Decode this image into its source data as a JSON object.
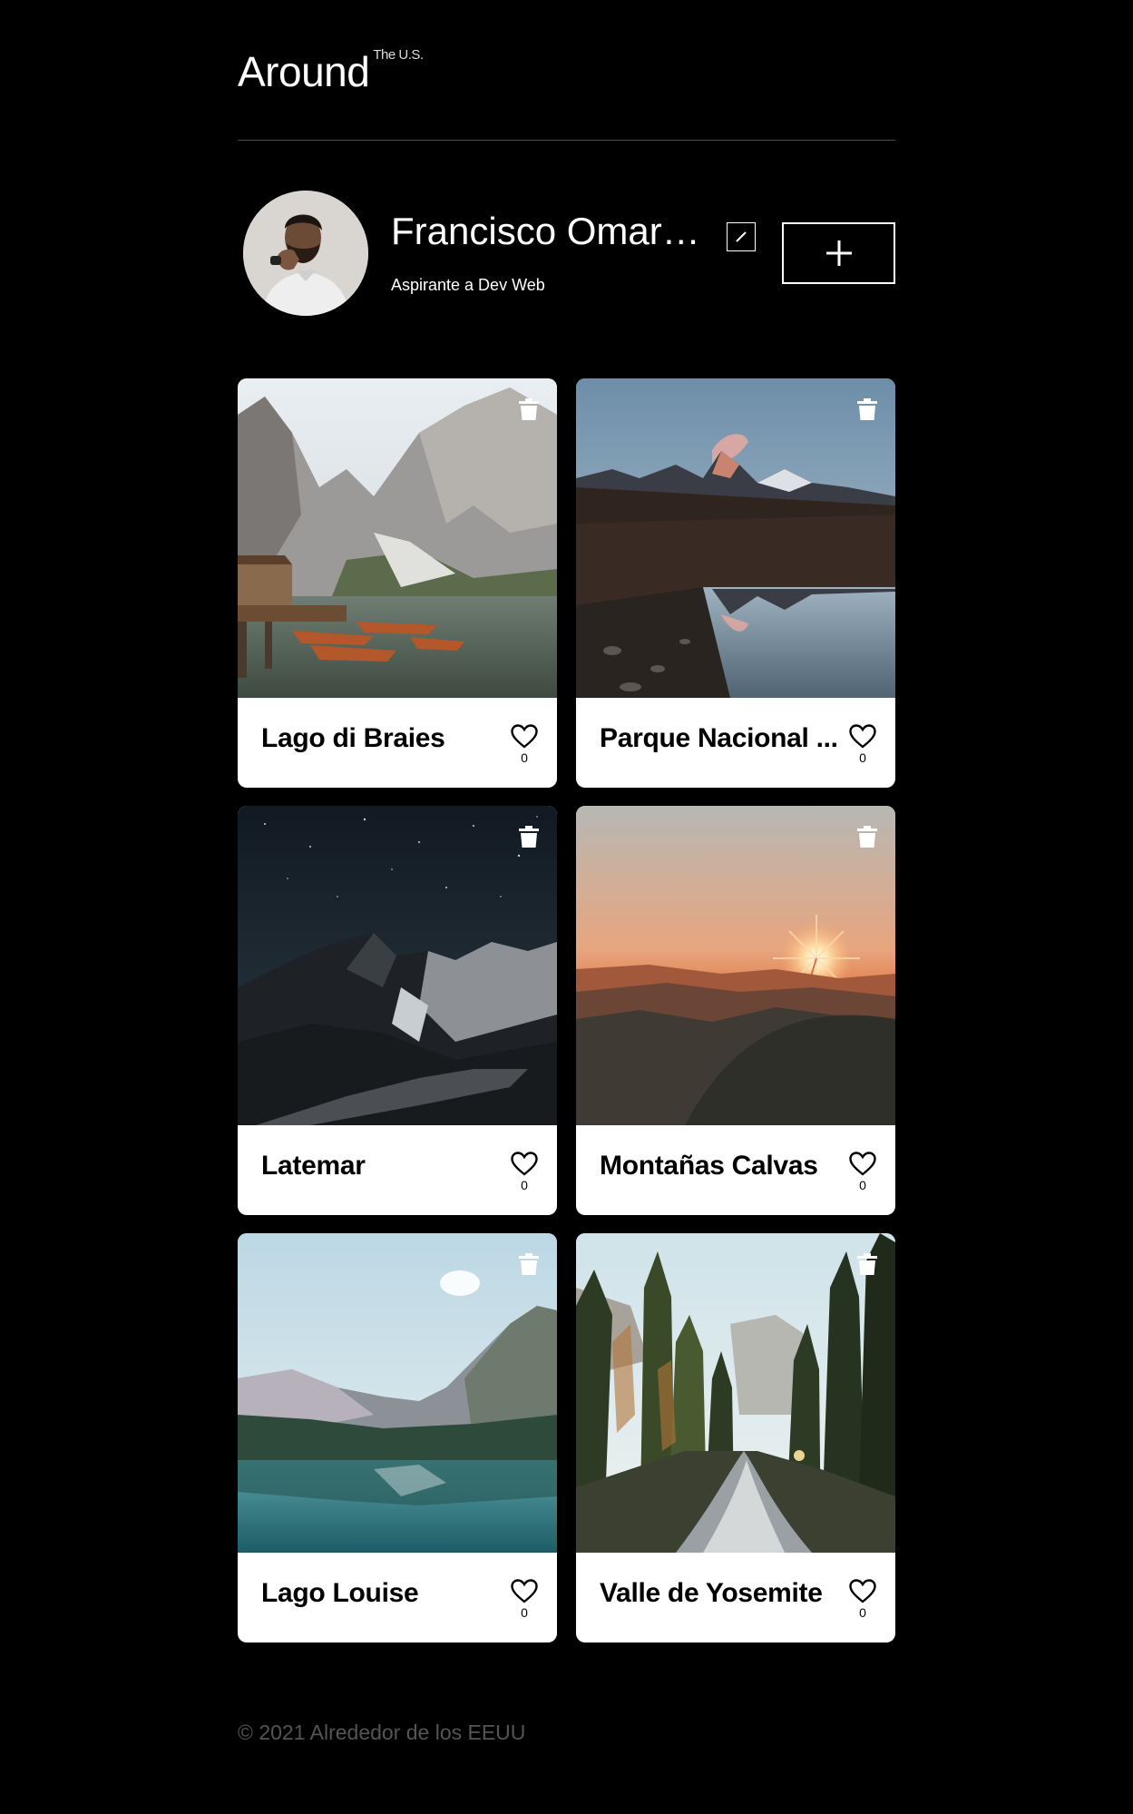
{
  "header": {
    "logo": "Around",
    "logo_sup": "The U.S."
  },
  "profile": {
    "name": "Francisco Omar ...",
    "job": "Aspirante a Dev Web",
    "edit_icon": "pencil-icon",
    "add_icon": "plus-icon"
  },
  "cards": [
    {
      "title": "Lago di Braies",
      "likes": "0"
    },
    {
      "title": "Parque Nacional ...",
      "likes": "0"
    },
    {
      "title": "Latemar",
      "likes": "0"
    },
    {
      "title": "Montañas Calvas",
      "likes": "0"
    },
    {
      "title": "Lago Louise",
      "likes": "0"
    },
    {
      "title": "Valle de Yosemite",
      "likes": "0"
    }
  ],
  "footer": {
    "copyright": "© 2021 Alrededor de los EEUU"
  },
  "colors": {
    "background": "#000000",
    "card": "#ffffff",
    "footer_text": "#545454"
  }
}
